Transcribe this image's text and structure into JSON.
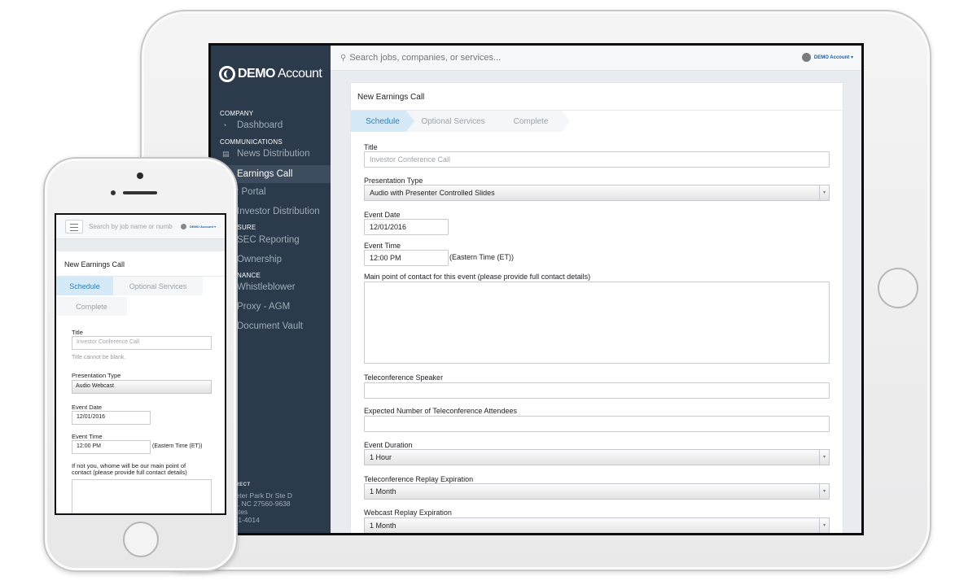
{
  "tablet": {
    "logo": {
      "bold": "DEMO",
      "light": "Account"
    },
    "sidebar": {
      "sections": [
        "COMPANY",
        "COMMUNICATIONS",
        "OSURE",
        "RNANCE"
      ],
      "items": [
        {
          "label": "Dashboard",
          "icon": "dashboard-icon"
        },
        {
          "label": "News Distribution",
          "icon": "document-icon"
        },
        {
          "label": "Earnings Call",
          "icon": "phone-icon"
        },
        {
          "label": "R Portal",
          "icon": "portal-icon"
        },
        {
          "label": "Investor Distribution",
          "icon": "mail-icon"
        },
        {
          "label": "SEC Reporting",
          "icon": "report-icon"
        },
        {
          "label": "Ownership",
          "icon": "ownership-icon"
        },
        {
          "label": "Whistleblower",
          "icon": "whistle-icon"
        },
        {
          "label": "Proxy - AGM",
          "icon": "proxy-icon"
        },
        {
          "label": "Document Vault",
          "icon": "vault-icon"
        }
      ],
      "footer": {
        "brand": "ERDIRECT",
        "lines": [
          "erimeter Park Dr Ste D",
          "sville, NC 27560-9638",
          "d States",
          "7) 481-4014"
        ]
      }
    },
    "topbar": {
      "search_placeholder": "Search jobs, companies, or services...",
      "account_label": "DEMO Account"
    },
    "form": {
      "card_title": "New Earnings Call",
      "steps": [
        "Schedule",
        "Optional Services",
        "Complete"
      ],
      "title_label": "Title",
      "title_placeholder": "Investor Conference Call",
      "presentation_type_label": "Presentation Type",
      "presentation_type_value": "Audio with Presenter Controlled Slides",
      "event_date_label": "Event Date",
      "event_date_value": "12/01/2016",
      "event_time_label": "Event Time",
      "event_time_value": "12:00 PM",
      "timezone_suffix": "(Eastern Time (ET))",
      "contact_label": "Main point of contact for this event (please provide full contact details)",
      "speaker_label": "Teleconference Speaker",
      "attendees_label": "Expected Number of Teleconference Attendees",
      "duration_label": "Event Duration",
      "duration_value": "1 Hour",
      "replay_label": "Teleconference Replay Expiration",
      "replay_value": "1 Month",
      "webcast_label": "Webcast Replay Expiration",
      "webcast_value": "1 Month"
    }
  },
  "phone": {
    "search_placeholder": "Search by job name or numb",
    "account_label": "DEMO Account",
    "card_title": "New Earnings Call",
    "steps": [
      "Schedule",
      "Optional Services",
      "Complete"
    ],
    "title_label": "Title",
    "title_placeholder": "Investor Conference Call",
    "title_error": "Title cannot be blank.",
    "presentation_type_label": "Presentation Type",
    "presentation_type_value": "Audio Webcast",
    "event_date_label": "Event Date",
    "event_date_value": "12/01/2016",
    "event_time_label": "Event Time",
    "event_time_value": "12:00 PM",
    "timezone_suffix": "(Eastern Time (ET))",
    "contact_label_1": "If not you, whome will be our main point of",
    "contact_label_2": "contact (please provide full contact details)"
  },
  "colors": {
    "sidebar_bg": "#2c3b4c",
    "active_step": "#d6e9f7",
    "active_step_text": "#2f7fb5"
  }
}
